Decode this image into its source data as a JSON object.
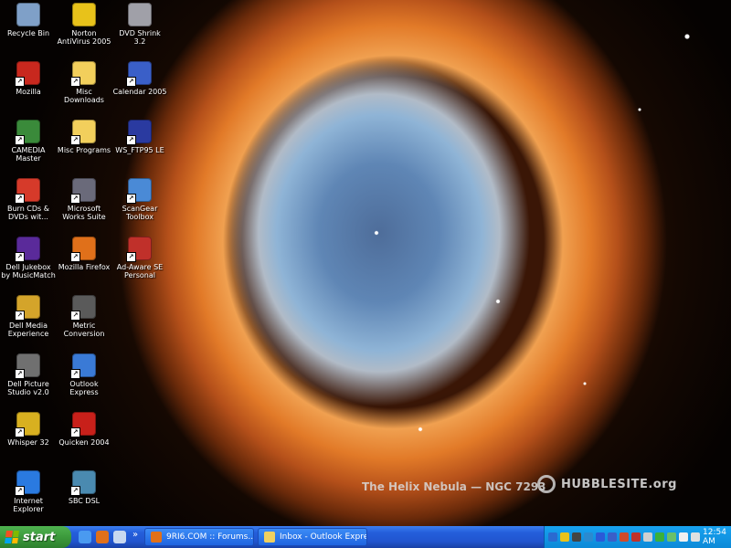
{
  "desktop": {
    "icons": [
      {
        "label": "Recycle Bin",
        "icon": "recycle-bin-icon",
        "color": "#7fa0c8"
      },
      {
        "label": "Norton AntiVirus 2005",
        "icon": "norton-antivirus-icon",
        "color": "#e8c21a"
      },
      {
        "label": "DVD Shrink 3.2",
        "icon": "dvd-shrink-icon",
        "color": "#a0a0a8"
      },
      {
        "label": "Mozilla",
        "icon": "mozilla-icon",
        "color": "#c8281e"
      },
      {
        "label": "Misc Downloads",
        "icon": "folder-icon",
        "color": "#f2cf5c"
      },
      {
        "label": "Calendar 2005",
        "icon": "calendar-icon",
        "color": "#3a5fc8"
      },
      {
        "label": "CAMEDIA Master",
        "icon": "camedia-icon",
        "color": "#3a8a3a"
      },
      {
        "label": "Misc Programs",
        "icon": "folder-icon",
        "color": "#f2cf5c"
      },
      {
        "label": "WS_FTP95 LE",
        "icon": "ws-ftp-icon",
        "color": "#2a3aa0"
      },
      {
        "label": "Burn CDs & DVDs wit...",
        "icon": "burn-cd-icon",
        "color": "#d63a2a"
      },
      {
        "label": "Microsoft Works Suite",
        "icon": "works-suite-icon",
        "color": "#6a6a7a"
      },
      {
        "label": "ScanGear Toolbox",
        "icon": "scangear-icon",
        "color": "#4a8ad6"
      },
      {
        "label": "Dell Jukebox by MusicMatch",
        "icon": "jukebox-icon",
        "color": "#5a2a9a"
      },
      {
        "label": "Mozilla Firefox",
        "icon": "firefox-icon",
        "color": "#e0701a"
      },
      {
        "label": "Ad-Aware SE Personal",
        "icon": "ad-aware-icon",
        "color": "#c0302a"
      },
      {
        "label": "Dell Media Experience",
        "icon": "media-experience-icon",
        "color": "#d4a42a"
      },
      {
        "label": "Metric Conversion",
        "icon": "metric-conversion-icon",
        "color": "#5a5a5a"
      },
      {
        "label": "",
        "icon": "",
        "color": ""
      },
      {
        "label": "Dell Picture Studio v2.0",
        "icon": "picture-studio-icon",
        "color": "#707070"
      },
      {
        "label": "Outlook Express",
        "icon": "outlook-express-icon",
        "color": "#3a7ad6"
      },
      {
        "label": "",
        "icon": "",
        "color": ""
      },
      {
        "label": "Whisper 32",
        "icon": "whisper-key-icon",
        "color": "#d8b020"
      },
      {
        "label": "Quicken 2004",
        "icon": "quicken-icon",
        "color": "#c8201a"
      },
      {
        "label": "",
        "icon": "",
        "color": ""
      },
      {
        "label": "Internet Explorer",
        "icon": "internet-explorer-icon",
        "color": "#2a7ae0"
      },
      {
        "label": "SBC DSL",
        "icon": "sbc-dsl-icon",
        "color": "#4a8ab0"
      }
    ],
    "wallpaper_caption": "The Helix Nebula — NGC 7293",
    "hubblesite": "HUBBLESITE.org"
  },
  "taskbar": {
    "start_label": "start",
    "quick_launch": [
      {
        "icon": "ie-quick-launch-icon",
        "color": "#4a9af0"
      },
      {
        "icon": "firefox-quick-launch-icon",
        "color": "#e0701a"
      },
      {
        "icon": "outlook-quick-launch-icon",
        "color": "#c8d8f0"
      }
    ],
    "overflow": "»",
    "tasks": [
      {
        "label": "9RI6.COM :: Forums...",
        "icon": "firefox-task-icon",
        "color": "#e0701a"
      },
      {
        "label": "Inbox - Outlook Express",
        "icon": "outlook-task-icon",
        "color": "#f0d060"
      }
    ],
    "tray_icons": [
      {
        "icon": "tray-dell-icon",
        "color": "#2a6ad0"
      },
      {
        "icon": "tray-norton-icon",
        "color": "#e8c21a"
      },
      {
        "icon": "tray-camera-icon",
        "color": "#444444"
      },
      {
        "icon": "tray-network-icon",
        "color": "#2a8ad0"
      },
      {
        "icon": "tray-update-icon",
        "color": "#2a5ad8"
      },
      {
        "icon": "tray-calendar-icon",
        "color": "#3a5fc8"
      },
      {
        "icon": "tray-shield-icon",
        "color": "#d04a2a"
      },
      {
        "icon": "tray-adaware-icon",
        "color": "#c0302a"
      },
      {
        "icon": "tray-volume-icon",
        "color": "#d0d0d0"
      },
      {
        "icon": "tray-security-icon",
        "color": "#3ab03a"
      },
      {
        "icon": "tray-phone-icon",
        "color": "#6ac06a"
      },
      {
        "icon": "tray-sync-icon",
        "color": "#f0f0f0"
      },
      {
        "icon": "tray-printer-icon",
        "color": "#e0e0e0"
      }
    ],
    "clock": "12:54 AM"
  }
}
